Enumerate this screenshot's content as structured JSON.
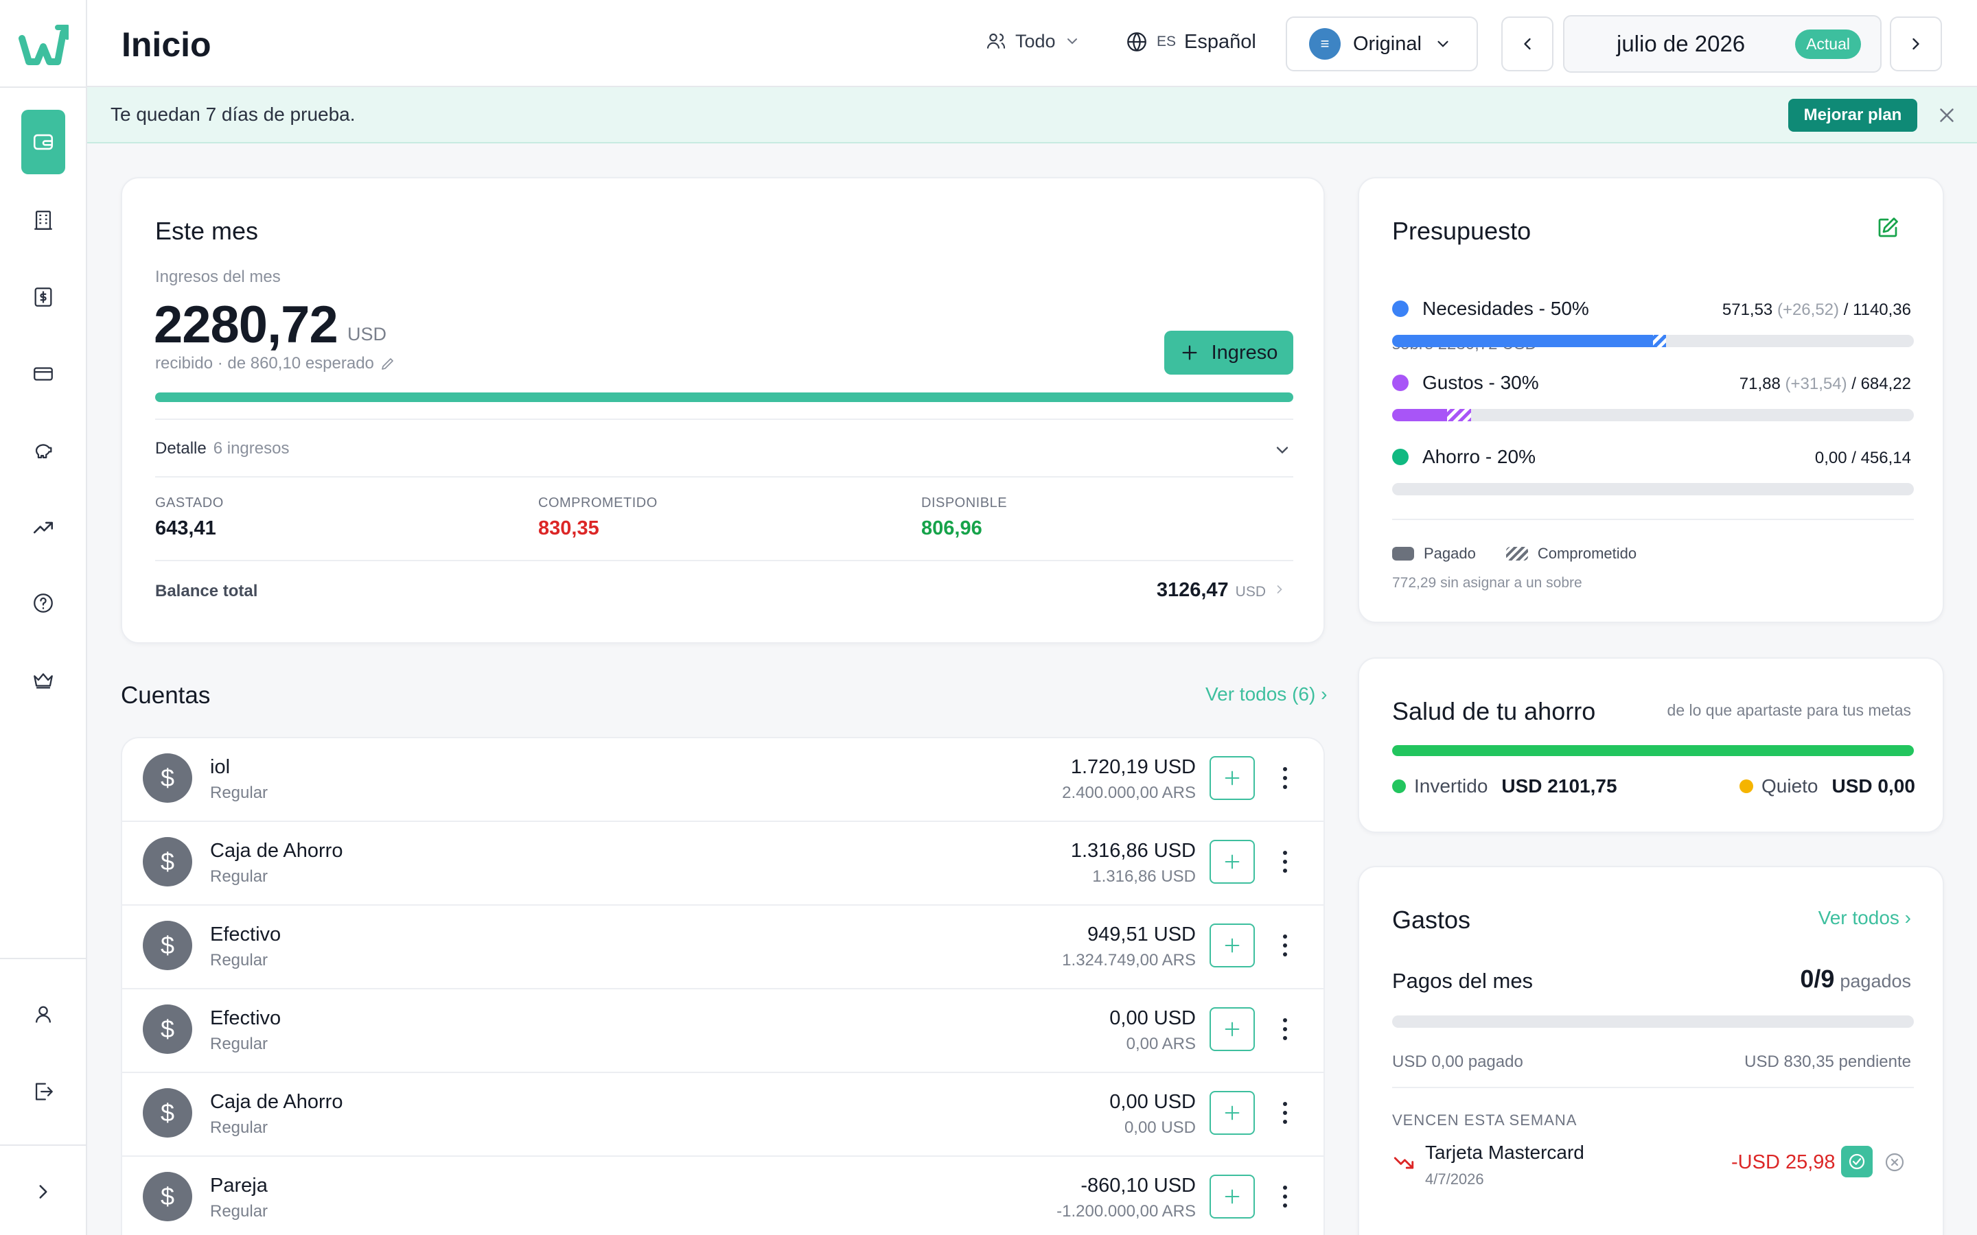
{
  "header": {
    "title": "Inicio",
    "filter_label": "Todo",
    "lang_code": "ES",
    "lang_label": "Español",
    "view_label": "Original",
    "view_icon": "≡",
    "month_label": "julio de 2026",
    "month_badge": "Actual"
  },
  "banner": {
    "text": "Te quedan 7 días de prueba.",
    "upgrade_label": "Mejorar plan"
  },
  "este_mes": {
    "title": "Este mes",
    "income_label": "Ingresos del mes",
    "income_amount": "2280,72",
    "income_currency": "USD",
    "received_text": "recibido · de 860,10 esperado",
    "income_progress": 1.0,
    "add_income_label": "Ingreso",
    "detail_label": "Detalle",
    "detail_count": "6 ingresos",
    "spent_label": "GASTADO",
    "spent_value": "643,41",
    "committed_label": "COMPROMETIDO",
    "committed_value": "830,35",
    "available_label": "DISPONIBLE",
    "available_value": "806,96",
    "balance_label": "Balance total",
    "balance_value": "3126,47",
    "balance_currency": "USD"
  },
  "cuentas": {
    "title": "Cuentas",
    "view_all_label": "Ver todos (6) ›",
    "items": [
      {
        "name": "iol",
        "type": "Regular",
        "amount": "1.720,19 USD",
        "sub_amount": "2.400.000,00 ARS",
        "avatar": "$"
      },
      {
        "name": "Caja de Ahorro",
        "type": "Regular",
        "amount": "1.316,86 USD",
        "sub_amount": "1.316,86 USD",
        "avatar": "$"
      },
      {
        "name": "Efectivo",
        "type": "Regular",
        "amount": "949,51 USD",
        "sub_amount": "1.324.749,00 ARS",
        "avatar": "$"
      },
      {
        "name": "Efectivo",
        "type": "Regular",
        "amount": "0,00 USD",
        "sub_amount": "0,00 ARS",
        "avatar": "$"
      },
      {
        "name": "Caja de Ahorro",
        "type": "Regular",
        "amount": "0,00 USD",
        "sub_amount": "0,00 USD",
        "avatar": "$"
      },
      {
        "name": "Pareja",
        "type": "Regular",
        "amount": "-860,10 USD",
        "sub_amount": "-1.200.000,00 ARS",
        "avatar": "$"
      }
    ]
  },
  "presupuesto": {
    "title": "Presupuesto",
    "subtitle": "sobre 2280,72 USD",
    "rows": [
      {
        "label": "Necesidades - 50%",
        "value": "571,53",
        "extra": "(+26,52)",
        "total": "/ 1140,36",
        "color": "#3b82f6",
        "paid_fraction": 0.5,
        "committed_fraction": 0.025
      },
      {
        "label": "Gustos - 30%",
        "value": "71,88",
        "extra": "(+31,54)",
        "total": "/ 684,22",
        "color": "#a855f7",
        "paid_fraction": 0.105,
        "committed_fraction": 0.046
      },
      {
        "label": "Ahorro - 20%",
        "value": "0,00",
        "extra": "",
        "total": "/ 456,14",
        "color": "#10b981",
        "paid_fraction": 0,
        "committed_fraction": 0
      }
    ],
    "legend_paid": "Pagado",
    "legend_committed": "Comprometido",
    "unassigned_text": "772,29 sin asignar a un sobre"
  },
  "salud": {
    "title": "Salud de tu ahorro",
    "subtitle": "de lo que apartaste para tus metas",
    "invested_label": "Invertido",
    "invested_value": "USD 2101,75",
    "idle_label": "Quieto",
    "idle_value": "USD 0,00",
    "invested_color": "#22c55e",
    "idle_color": "#f5b400"
  },
  "gastos": {
    "title": "Gastos",
    "view_all_label": "Ver todos ›",
    "payments_label": "Pagos del mes",
    "payments_count": "0/9",
    "payments_suffix": "pagados",
    "paid_text": "USD 0,00 pagado",
    "pending_text": "USD 830,35 pendiente",
    "due_section_label": "VENCEN ESTA SEMANA",
    "due_items": [
      {
        "name": "Tarjeta Mastercard",
        "date": "4/7/2026",
        "amount": "-USD 25,98"
      }
    ]
  },
  "colors": {
    "accent": "#3dbf9e",
    "accent_dark": "#0f8a76",
    "negative": "#dc2626",
    "positive": "#16a34a"
  }
}
